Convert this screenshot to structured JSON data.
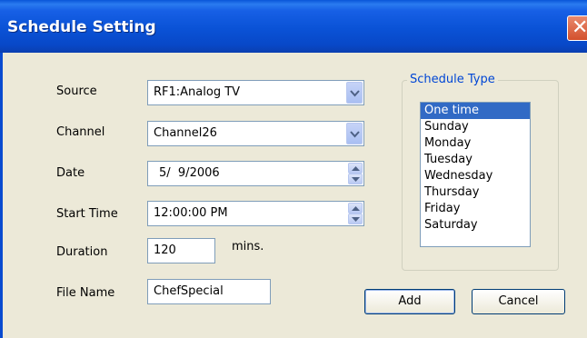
{
  "window": {
    "title": "Schedule Setting"
  },
  "form": {
    "source": {
      "label": "Source",
      "value": "RF1:Analog TV"
    },
    "channel": {
      "label": "Channel",
      "value": "Channel26"
    },
    "date": {
      "label": "Date",
      "value": "5/  9/2006"
    },
    "start_time": {
      "label": "Start Time",
      "value": "12:00:00 PM"
    },
    "duration": {
      "label": "Duration",
      "value": "120",
      "unit": "mins."
    },
    "file_name": {
      "label": "File Name",
      "value": "ChefSpecial"
    }
  },
  "schedule_type": {
    "label": "Schedule Type",
    "items": [
      "One time",
      "Sunday",
      "Monday",
      "Tuesday",
      "Wednesday",
      "Thursday",
      "Friday",
      "Saturday"
    ],
    "selected": "One time"
  },
  "buttons": {
    "add": "Add",
    "cancel": "Cancel"
  },
  "icons": {
    "close": "close-icon",
    "dropdown": "chevron-down-icon",
    "spin_up": "arrow-up-icon",
    "spin_down": "arrow-down-icon"
  },
  "colors": {
    "titlebar": "#0a52d6",
    "selection": "#316ac5",
    "group_label": "#0046d5",
    "dialog_bg": "#ece9d8"
  }
}
